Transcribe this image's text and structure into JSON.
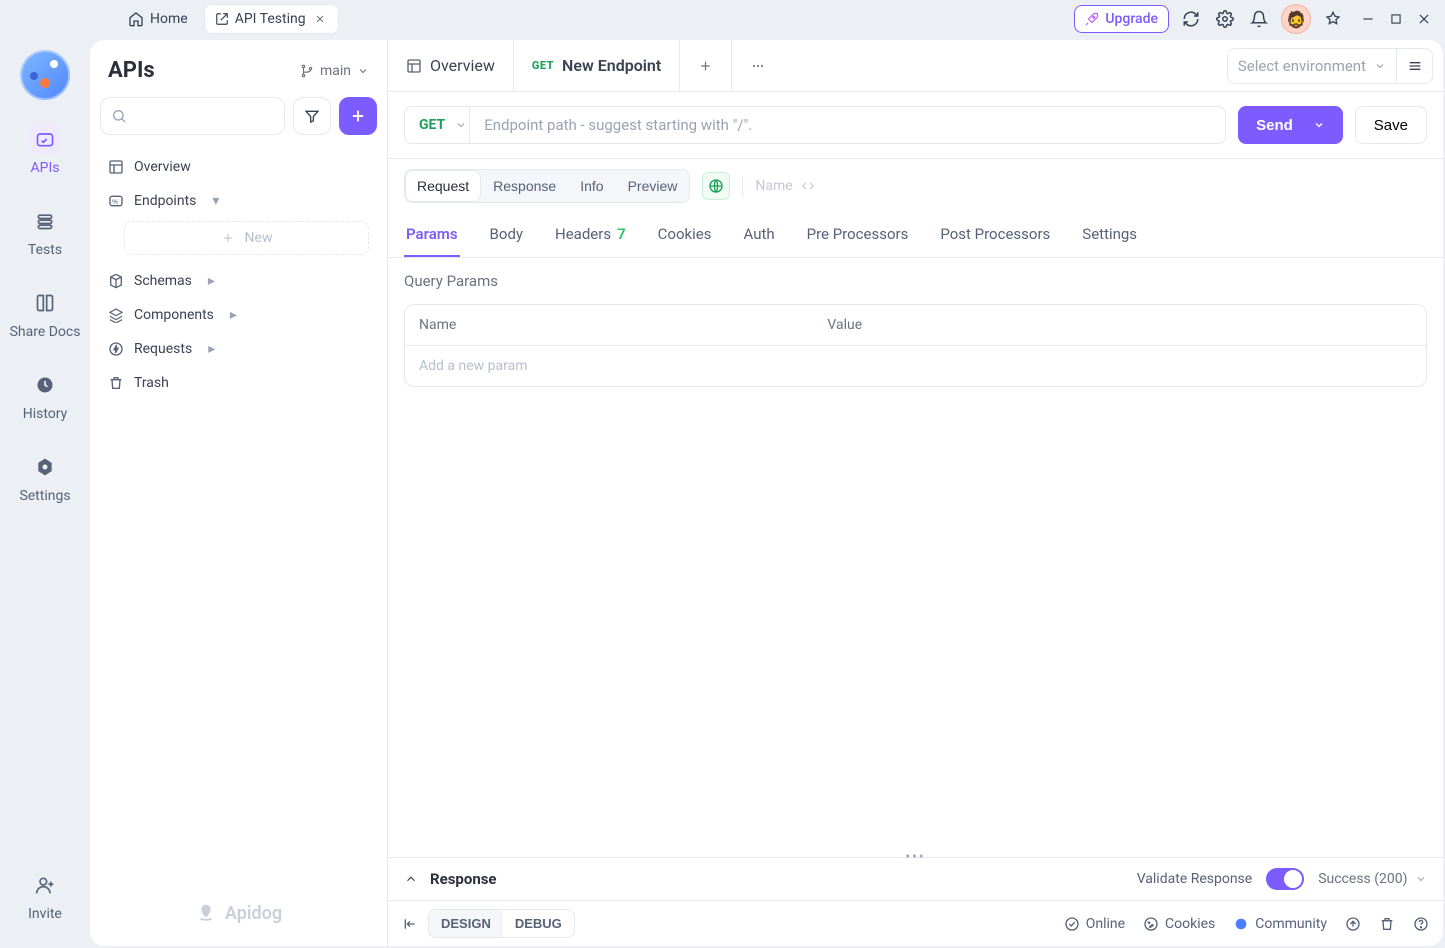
{
  "titlebar": {
    "home_tab": "Home",
    "project_tab": "API Testing",
    "upgrade": "Upgrade"
  },
  "navrail": {
    "items": [
      {
        "label": "APIs"
      },
      {
        "label": "Tests"
      },
      {
        "label": "Share Docs"
      },
      {
        "label": "History"
      },
      {
        "label": "Settings"
      }
    ],
    "invite": "Invite"
  },
  "sidebar": {
    "title": "APIs",
    "branch": "main",
    "tree": {
      "overview": "Overview",
      "endpoints": "Endpoints",
      "new_item": "New",
      "schemas": "Schemas",
      "components": "Components",
      "requests": "Requests",
      "trash": "Trash"
    },
    "brand": "Apidog"
  },
  "tabs": {
    "overview": "Overview",
    "new_endpoint_method": "GET",
    "new_endpoint_label": "New Endpoint",
    "env_placeholder": "Select environment"
  },
  "request": {
    "method": "GET",
    "url_placeholder": "Endpoint path - suggest starting with \"/\".",
    "send": "Send",
    "save": "Save",
    "name_placeholder": "Name",
    "seg": {
      "request": "Request",
      "response": "Response",
      "info": "Info",
      "preview": "Preview"
    },
    "subtabs": {
      "params": "Params",
      "body": "Body",
      "headers": "Headers",
      "headers_count": "7",
      "cookies": "Cookies",
      "auth": "Auth",
      "pre": "Pre Processors",
      "post": "Post Processors",
      "settings": "Settings"
    },
    "query_params_title": "Query Params",
    "table": {
      "col_name": "Name",
      "col_value": "Value",
      "add_placeholder": "Add a new param"
    }
  },
  "response": {
    "title": "Response",
    "validate_label": "Validate Response",
    "status": "Success (200)"
  },
  "footer": {
    "design": "DESIGN",
    "debug": "DEBUG",
    "online": "Online",
    "cookies": "Cookies",
    "community": "Community"
  }
}
